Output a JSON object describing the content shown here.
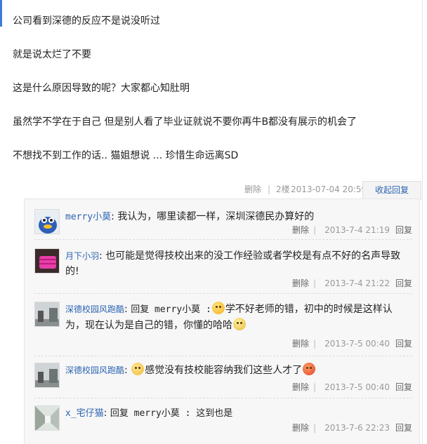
{
  "post": {
    "lines": [
      "公司看到深德的反应不是说没听过",
      "就是说太烂了不要",
      "这是什么原因导致的呢？大家都心知肚明",
      "虽然学不学在于自己 但是别人看了毕业证就说不要你再牛B都没有展示的机会了",
      "不想找不到工作的话.. 猫姐想说 ... 珍惜生命远离SD"
    ],
    "meta": {
      "delete_label": "删除",
      "separator": "|",
      "floor": "2楼",
      "time": "2013-07-04 20:59",
      "collapse_label": "收起回复"
    }
  },
  "replies": [
    {
      "user": "merry小莫",
      "colon": ":",
      "text_parts": [
        "我认为，哪里读都一样，深圳深德民办算好的"
      ],
      "delete_label": "删除",
      "separator": "|",
      "time": "2013-7-4 21:19",
      "reply_label": "回复",
      "avatar_icon": "blue-creature-avatar"
    },
    {
      "user": "月下小羽",
      "colon": ":",
      "text_parts": [
        "也可能是觉得技校出来的没工作经验或者学校是有点不好的名声导致的!"
      ],
      "delete_label": "删除",
      "separator": "|",
      "time": "2013-7-4 21:22",
      "reply_label": "回复",
      "avatar_icon": "pink-object-avatar"
    },
    {
      "user": "深德校园风跑酷",
      "colon": ":",
      "reply_prefix": "回复 merry小莫 :",
      "text_parts": [
        "学不好老师的错，初中的时候是这样认为，现在认为是自己的错，你懂的哈哈"
      ],
      "emojis": [
        "tongue-emoji",
        "thinking-emoji"
      ],
      "delete_label": "删除",
      "separator": "|",
      "time": "2013-7-5 00:40",
      "reply_label": "回复",
      "avatar_icon": "street-photo-avatar"
    },
    {
      "user": "深德校园风跑酷",
      "colon": ":",
      "text_parts": [
        "感觉没有技校能容纳我们这些人才了"
      ],
      "emojis": [
        "grin-emoji",
        "angry-emoji"
      ],
      "delete_label": "删除",
      "separator": "|",
      "time": "2013-7-5 00:40",
      "reply_label": "回复",
      "avatar_icon": "street-photo-avatar"
    },
    {
      "user": "x_宅仔猫",
      "colon": ":",
      "text_parts": [
        "回复 merry小莫 : 这到也是"
      ],
      "delete_label": "删除",
      "separator": "|",
      "time": "2013-7-6 22:23",
      "reply_label": "回复",
      "avatar_icon": "corridor-photo-avatar"
    }
  ],
  "colors": {
    "link": "#2d64b3",
    "meta": "#999999",
    "accent": "#3c7bd8",
    "reply_bg": "#f7f7f7"
  }
}
